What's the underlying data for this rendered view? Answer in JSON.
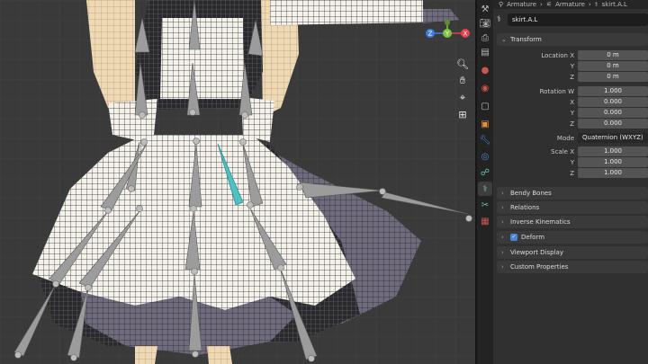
{
  "breadcrumb": {
    "items": [
      "Armature",
      "Armature",
      "skirt.A.L"
    ]
  },
  "bone_name": "skirt.A.L",
  "transform": {
    "header": "Transform",
    "location": {
      "label_x": "Location X",
      "label_y": "Y",
      "label_z": "Z",
      "x": "0 m",
      "y": "0 m",
      "z": "0 m"
    },
    "rotation": {
      "label_w": "Rotation W",
      "label_x": "X",
      "label_y": "Y",
      "label_z": "Z",
      "w": "1.000",
      "x": "0.000",
      "y": "0.000",
      "z": "0.000"
    },
    "mode": {
      "label": "Mode",
      "value": "Quaternion (WXYZ)"
    },
    "scale": {
      "label_x": "Scale X",
      "label_y": "Y",
      "label_z": "Z",
      "x": "1.000",
      "y": "1.000",
      "z": "1.000"
    }
  },
  "panels": {
    "bendy_bones": "Bendy Bones",
    "relations": "Relations",
    "inverse_kinematics": "Inverse Kinematics",
    "deform": "Deform",
    "viewport_display": "Viewport Display",
    "custom_properties": "Custom Properties"
  },
  "deform_enabled": true,
  "gizmo": {
    "x_label": "X",
    "y_label": "Y",
    "z_label": "Z",
    "x_color": "#e0434c",
    "y_color": "#7fc53a",
    "z_color": "#3f7de0"
  },
  "colors": {
    "viewport_bg": "#3a3a3a",
    "active_bone": "#4fc1c4",
    "bone": "#9a9a9a",
    "panel_bg": "#303030"
  }
}
